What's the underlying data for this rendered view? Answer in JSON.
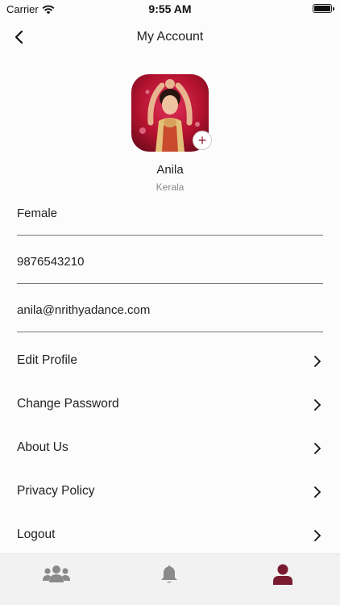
{
  "status_bar": {
    "carrier": "Carrier",
    "time": "9:55 AM"
  },
  "nav": {
    "title": "My Account",
    "back_icon": "chevron-left-icon"
  },
  "profile": {
    "name": "Anila",
    "location": "Kerala",
    "add_photo_icon": "plus-icon"
  },
  "fields": {
    "gender": "Female",
    "phone": "9876543210",
    "email": "anila@nrithyadance.com"
  },
  "menu": [
    {
      "label": "Edit Profile"
    },
    {
      "label": "Change Password"
    },
    {
      "label": "About Us"
    },
    {
      "label": "Privacy Policy"
    },
    {
      "label": "Logout"
    }
  ],
  "tab_bar": {
    "tabs": [
      {
        "icon": "users-icon",
        "active": false
      },
      {
        "icon": "bell-icon",
        "active": false
      },
      {
        "icon": "user-icon",
        "active": true
      }
    ],
    "active_color": "#7a1a2e",
    "inactive_color": "#8a8a8a"
  },
  "colors": {
    "accent": "#8a1e33",
    "divider": "#777777"
  }
}
